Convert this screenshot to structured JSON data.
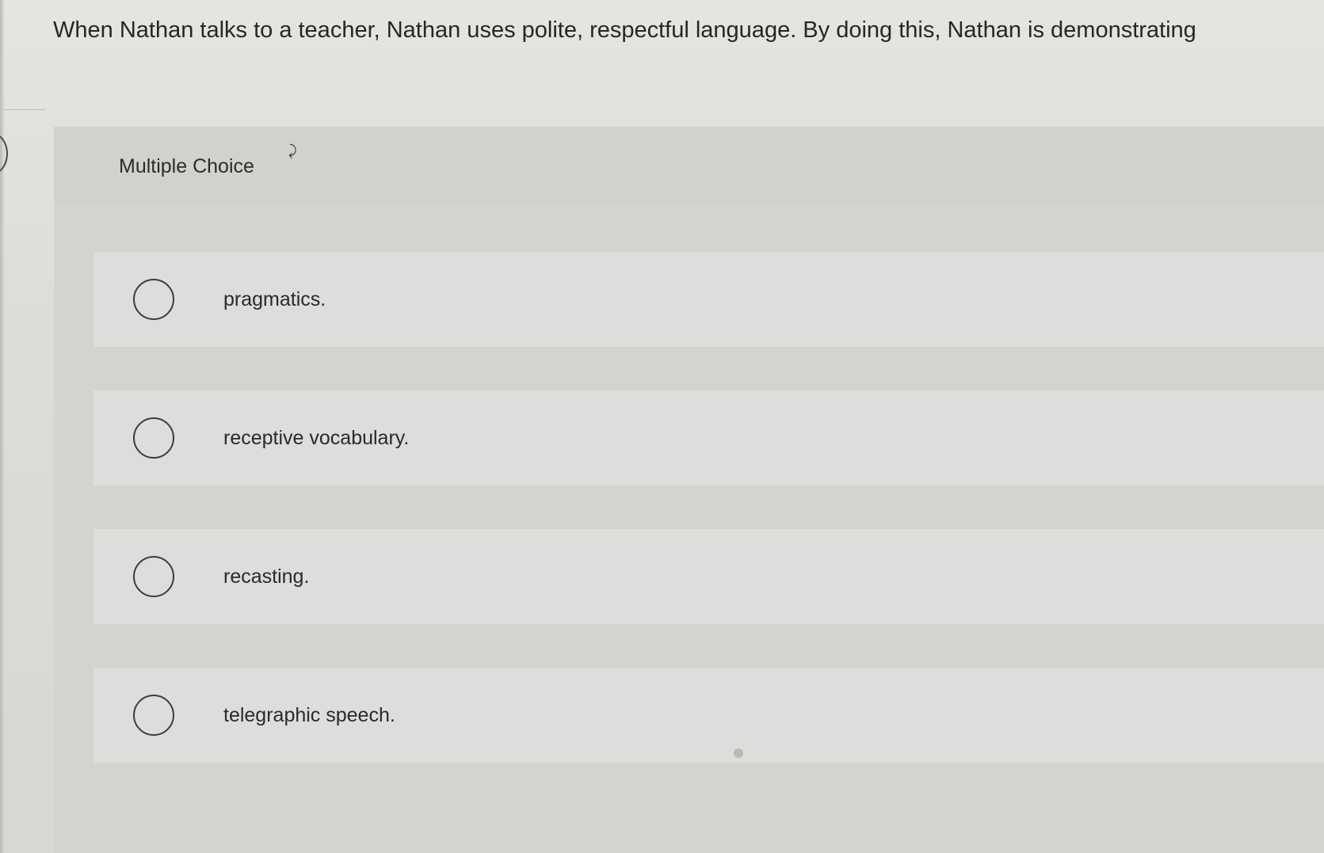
{
  "question": {
    "text": "When Nathan talks to a teacher, Nathan uses polite, respectful language. By doing this, Nathan is demonstrating"
  },
  "card": {
    "title": "Multiple Choice"
  },
  "options": [
    {
      "label": "pragmatics.",
      "selected": false
    },
    {
      "label": "receptive vocabulary.",
      "selected": false
    },
    {
      "label": "recasting.",
      "selected": false
    },
    {
      "label": "telegraphic speech.",
      "selected": false
    }
  ],
  "colors": {
    "background": "#dcdcd9",
    "card": "#d3d3d0",
    "option_row": "#dddddb",
    "text": "#2a2a2a",
    "radio_border": "#3c3c3c"
  }
}
